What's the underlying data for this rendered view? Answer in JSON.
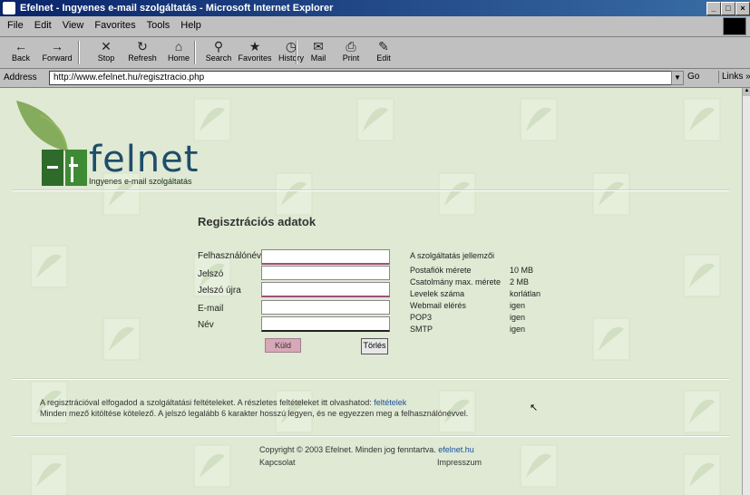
{
  "window": {
    "title": "Efelnet - Ingyenes e-mail szolgáltatás - Microsoft Internet Explorer"
  },
  "menu": {
    "items": [
      "File",
      "Edit",
      "View",
      "Favorites",
      "Tools",
      "Help"
    ]
  },
  "toolbar": {
    "buttons": [
      {
        "label": "Back",
        "icon": "back-arrow-icon",
        "glyph": "←"
      },
      {
        "label": "Forward",
        "icon": "forward-arrow-icon",
        "glyph": "→"
      },
      {
        "label": "Stop",
        "icon": "stop-icon",
        "glyph": "✕"
      },
      {
        "label": "Refresh",
        "icon": "refresh-icon",
        "glyph": "↻"
      },
      {
        "label": "Home",
        "icon": "home-icon",
        "glyph": "⌂"
      },
      {
        "label": "Search",
        "icon": "search-icon",
        "glyph": "⚲"
      },
      {
        "label": "Favorites",
        "icon": "favorites-icon",
        "glyph": "★"
      },
      {
        "label": "History",
        "icon": "history-icon",
        "glyph": "◷"
      },
      {
        "label": "Mail",
        "icon": "mail-icon",
        "glyph": "✉"
      },
      {
        "label": "Print",
        "icon": "print-icon",
        "glyph": "⎙"
      },
      {
        "label": "Edit",
        "icon": "edit-icon",
        "glyph": "✎"
      }
    ]
  },
  "address": {
    "label": "Address",
    "value": "http://www.efelnet.hu/regisztracio.php",
    "go_label": "Go",
    "links_label": "Links »"
  },
  "page": {
    "logo_text": "felnet",
    "logo_letter": "E",
    "tagline": "Ingyenes e-mail szolgáltatás",
    "form_title": "Regisztrációs adatok",
    "fields": [
      {
        "label": "Felhasználónév"
      },
      {
        "label": "Jelszó"
      },
      {
        "label": "Jelszó újra"
      },
      {
        "label": "E-mail"
      },
      {
        "label": "Név"
      }
    ],
    "send_label": "Küld",
    "clear_label": "Törlés",
    "info_header": "A szolgáltatás jellemzői",
    "info_rows": [
      {
        "k": "Postafiók mérete",
        "v": "10 MB"
      },
      {
        "k": "Csatolmány max. mérete",
        "v": "2 MB"
      },
      {
        "k": "Levelek száma",
        "v": "korlátlan"
      },
      {
        "k": "Webmail elérés",
        "v": "igen"
      },
      {
        "k": "POP3",
        "v": "igen"
      },
      {
        "k": "SMTP",
        "v": "igen"
      }
    ],
    "para_line1": "A regisztrációval elfogadod a szolgáltatási feltételeket. A részletes feltételeket itt olvashatod: ",
    "para_link": "feltételek",
    "para_line2": "Minden mező kitöltése kötelező. A jelszó legalább 6 karakter hosszú legyen, és ne egyezzen meg a felhasználónévvel.",
    "footer_line1": "Copyright © 2003 Efelnet. Minden jog fenntartva. ",
    "footer_link1": "efelnet.hu",
    "footer_left2": "Kapcsolat",
    "footer_right2": "Impresszum"
  },
  "colors": {
    "content_bg": "#dfe9d3",
    "logo_blue": "#1e4d6a",
    "leaf_green": "#6e9b3e",
    "required_underline": "#a0507a"
  }
}
